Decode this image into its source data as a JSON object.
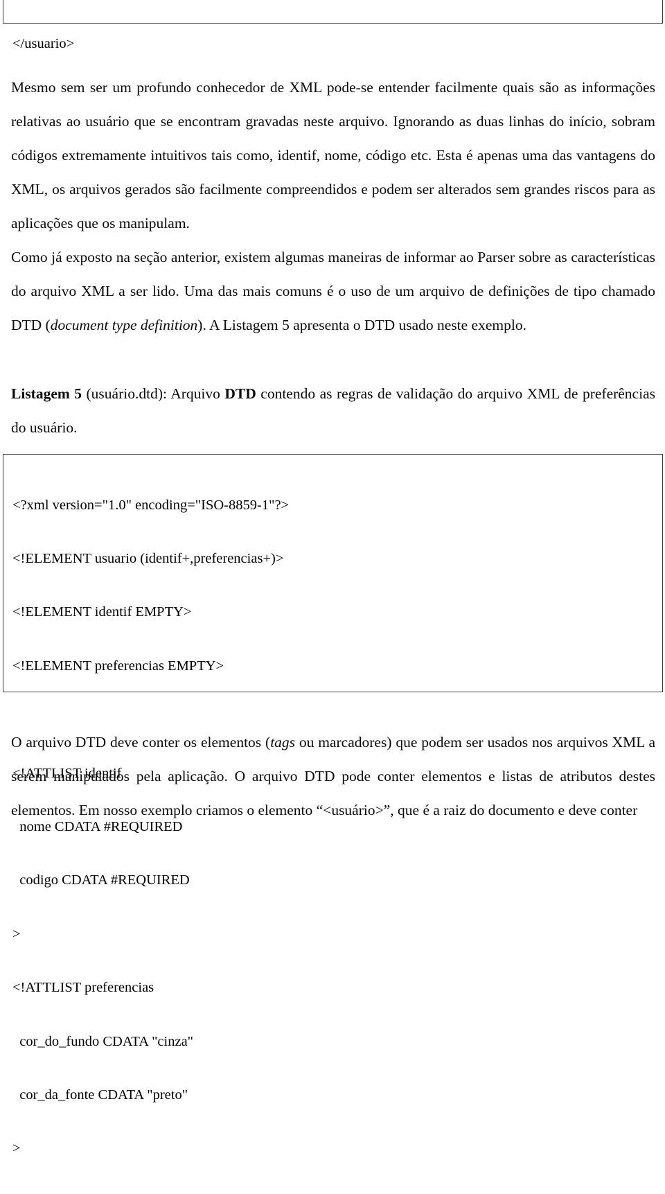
{
  "document": {
    "language": "pt-BR",
    "top_code_box": {
      "continued_from_previous_page": true,
      "lines": [
        "</usuario>"
      ]
    },
    "paragraph_1": "Mesmo sem ser um profundo conhecedor de XML pode-se entender facilmente quais são as informações relativas ao usuário que se encontram gravadas neste arquivo. Ignorando as duas linhas do início, sobram códigos extremamente intuitivos tais como, identif, nome, código etc. Esta é apenas uma das vantagens do XML, os arquivos gerados são facilmente compreendidos e podem ser alterados sem grandes riscos para as aplicações que os manipulam.",
    "paragraph_2_part1": "Como já exposto na seção anterior, existem algumas maneiras de informar ao Parser sobre as características do arquivo XML a ser lido. Uma das mais comuns é o uso de um arquivo de definições de tipo chamado DTD (",
    "paragraph_2_italic": "document type definition",
    "paragraph_2_part2": "). A Listagem 5 apresenta o DTD usado neste exemplo.",
    "caption": {
      "label": "Listagem 5",
      "part1": " (usuário.dtd): Arquivo ",
      "bold2": "DTD",
      "part2": " contendo as regras de validação do arquivo XML de preferências do usuário."
    },
    "listing_code_box": {
      "lines": [
        "<?xml version=\"1.0\" encoding=\"ISO-8859-1\"?>",
        "<!ELEMENT usuario (identif+,preferencias+)>",
        "<!ELEMENT identif EMPTY>",
        "<!ELEMENT preferencias EMPTY>",
        "",
        "<!ATTLIST identif",
        "  nome CDATA #REQUIRED",
        "  codigo CDATA #REQUIRED",
        ">",
        "<!ATTLIST preferencias",
        "  cor_do_fundo CDATA \"cinza\"",
        "  cor_da_fonte CDATA \"preto\"",
        ">"
      ]
    },
    "paragraph_4_part1": "O arquivo DTD deve conter os elementos (",
    "paragraph_4_italic": "tags",
    "paragraph_4_part2": " ou marcadores) que podem ser usados nos arquivos XML a serem manipulados pela aplicação. O arquivo DTD pode conter elementos e listas de atributos destes elementos. Em nosso exemplo criamos o elemento “<usuário>”, que é a raiz do documento e deve conter"
  },
  "colors": {
    "text": "#0a0a0a",
    "box_border": "#3a3a3a",
    "background": "#ffffff"
  }
}
